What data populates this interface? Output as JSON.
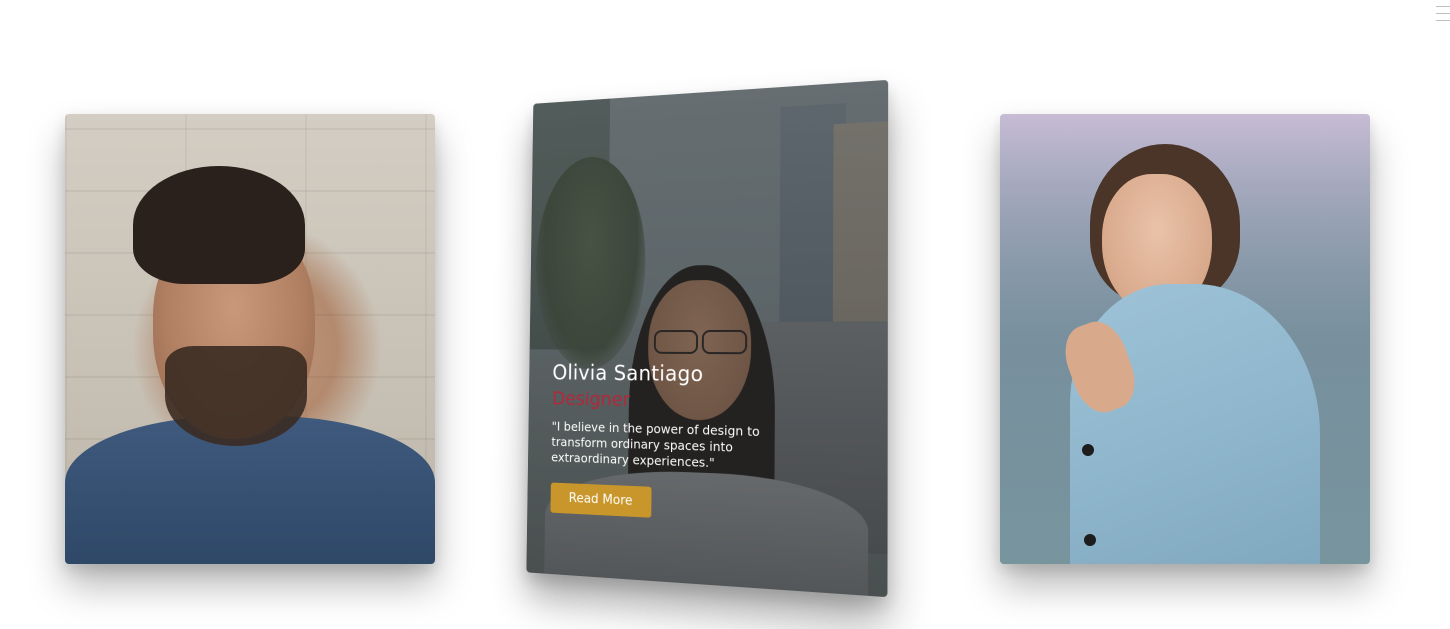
{
  "cards": [
    {
      "id": "left",
      "image_alt": "man-portrait"
    },
    {
      "id": "center",
      "name": "Olivia Santiago",
      "role": "Designer",
      "quote": "\"I believe in the power of design to transform ordinary spaces into extraordinary experiences.\"",
      "button_label": "Read More",
      "image_alt": "woman-portrait-street"
    },
    {
      "id": "right",
      "image_alt": "woman-portrait-blazer"
    }
  ],
  "colors": {
    "accent_button": "#c8962a",
    "role_text": "#b3283a",
    "overlay": "rgba(40,44,48,0.38)",
    "background": "#ffffff"
  },
  "icons": {
    "menu": "menu-icon"
  }
}
